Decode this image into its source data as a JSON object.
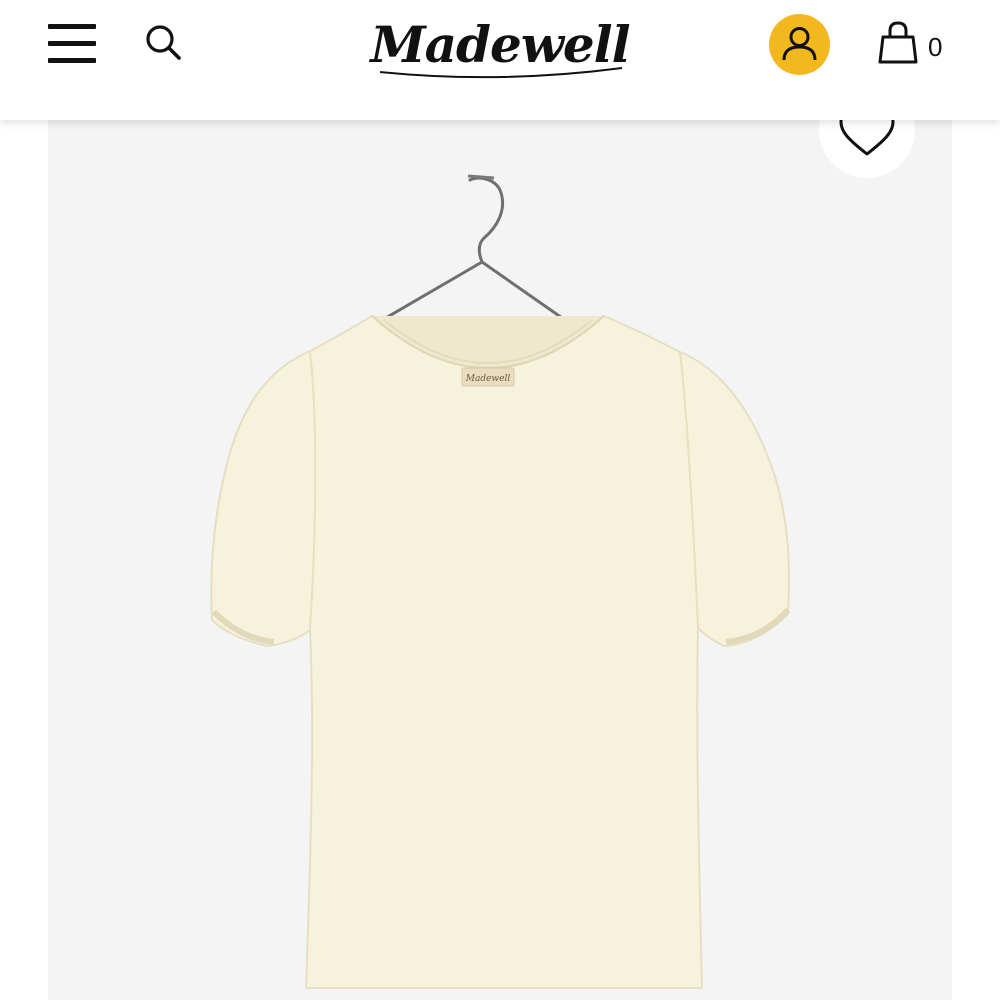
{
  "header": {
    "brand": "Madewell",
    "bag_count": "0",
    "icons": {
      "menu": "hamburger-menu-icon",
      "search": "search-icon",
      "account": "account-icon",
      "bag": "shopping-bag-icon"
    }
  },
  "product": {
    "image": "cream-puff-sleeve-tee-on-hanger",
    "label_text": "Madewell",
    "wishlist_icon": "heart-icon"
  },
  "colors": {
    "account_badge": "#F2B81E",
    "garment": "#F7F2DC",
    "image_bg": "#F4F4F4"
  }
}
